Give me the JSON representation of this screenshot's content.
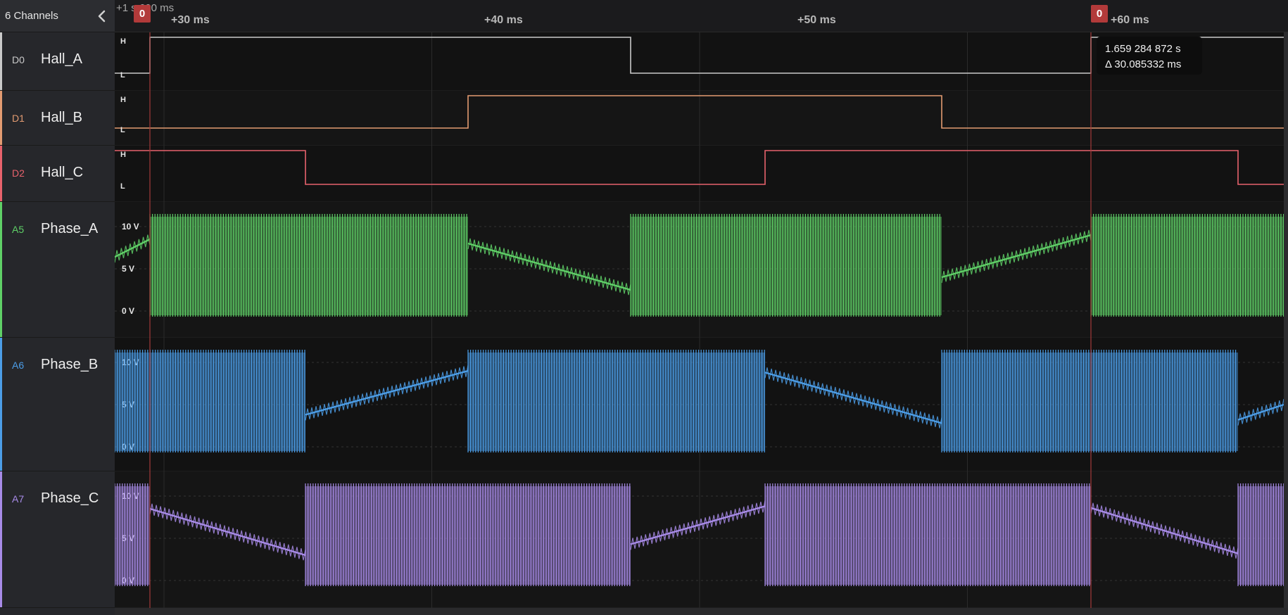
{
  "sidebar": {
    "title": "6 Channels",
    "channels": [
      {
        "id": "D0",
        "name": "Hall_A",
        "color": "#c9c9c9"
      },
      {
        "id": "D1",
        "name": "Hall_B",
        "color": "#e39b71"
      },
      {
        "id": "D2",
        "name": "Hall_C",
        "color": "#e8626c"
      },
      {
        "id": "A5",
        "name": "Phase_A",
        "color": "#5fd067"
      },
      {
        "id": "A6",
        "name": "Phase_B",
        "color": "#4c9ee8"
      },
      {
        "id": "A7",
        "name": "Phase_C",
        "color": "#a88be8"
      }
    ]
  },
  "ruler": {
    "origin_label": "+1 s 600 ms",
    "ticks": [
      "+30 ms",
      "+40 ms",
      "+50 ms",
      "+60 ms"
    ]
  },
  "markers": [
    {
      "label": "0"
    },
    {
      "label": "0"
    }
  ],
  "tooltip": {
    "time": "1.659 284 872 s",
    "delta": "Δ 30.085332 ms"
  },
  "digital_levels": {
    "high": "H",
    "low": "L"
  },
  "analog_levels": [
    "10 V",
    "5 V",
    "0 V"
  ]
}
